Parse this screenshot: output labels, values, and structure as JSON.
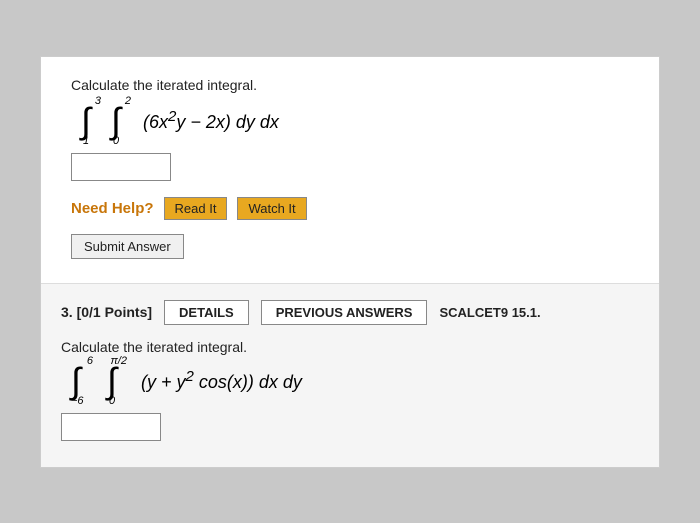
{
  "problem1": {
    "instruction": "Calculate the iterated integral.",
    "integral_text": "∫₁³ ∫₀² (6x²y − 2x) dy dx",
    "outer_lower": "1",
    "outer_upper": "3",
    "inner_lower": "0",
    "inner_upper": "2",
    "integrand": "(6x²y − 2x) dy dx",
    "need_help_label": "Need Help?",
    "read_it_label": "Read It",
    "watch_it_label": "Watch It",
    "submit_label": "Submit Answer"
  },
  "problem2": {
    "number": "3.",
    "points": "[0/1 Points]",
    "details_label": "DETAILS",
    "prev_answers_label": "PREVIOUS ANSWERS",
    "scalcet_ref": "SCALCET9 15.1.",
    "instruction": "Calculate the iterated integral.",
    "outer_lower": "−6",
    "outer_upper": "6",
    "inner_lower": "0",
    "inner_upper": "π/2",
    "integrand": "(y + y² cos(x)) dx dy"
  }
}
